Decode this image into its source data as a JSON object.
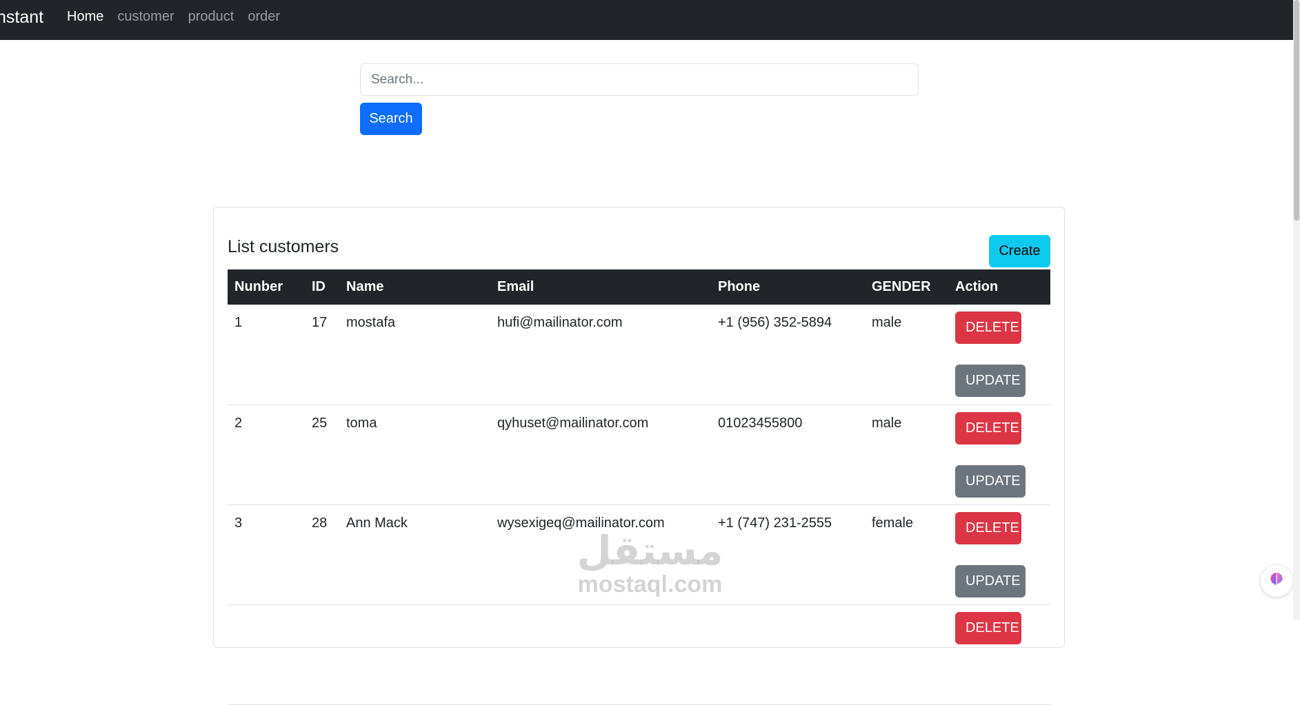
{
  "navbar": {
    "brand": "nstant",
    "links": [
      {
        "label": "Home",
        "active": true
      },
      {
        "label": "customer",
        "active": false
      },
      {
        "label": "product",
        "active": false
      },
      {
        "label": "order",
        "active": false
      }
    ]
  },
  "search": {
    "placeholder": "Search...",
    "button_label": "Search"
  },
  "card": {
    "title": "List customers",
    "create_label": "Create"
  },
  "table": {
    "headers": [
      "Nunber",
      "ID",
      "Name",
      "Email",
      "Phone",
      "GENDER",
      "Action"
    ],
    "rows": [
      {
        "number": "1",
        "id": "17",
        "name": "mostafa",
        "email": "hufi@mailinator.com",
        "phone": "+1 (956) 352-5894",
        "gender": "male"
      },
      {
        "number": "2",
        "id": "25",
        "name": "toma",
        "email": "qyhuset@mailinator.com",
        "phone": "01023455800",
        "gender": "male"
      },
      {
        "number": "3",
        "id": "28",
        "name": "Ann Mack",
        "email": "wysexigeq@mailinator.com",
        "phone": "+1 (747) 231-2555",
        "gender": "female"
      }
    ],
    "delete_label": "DELETE",
    "update_label": "UPDATE"
  },
  "watermark": {
    "arabic": "مستقل",
    "latin": "mostaql.com"
  },
  "colors": {
    "navbar_bg": "#212529",
    "primary": "#0d6efd",
    "info": "#0dcaf0",
    "danger": "#dc3545",
    "secondary": "#6c757d"
  },
  "icons": {
    "widget": "brain-icon"
  }
}
